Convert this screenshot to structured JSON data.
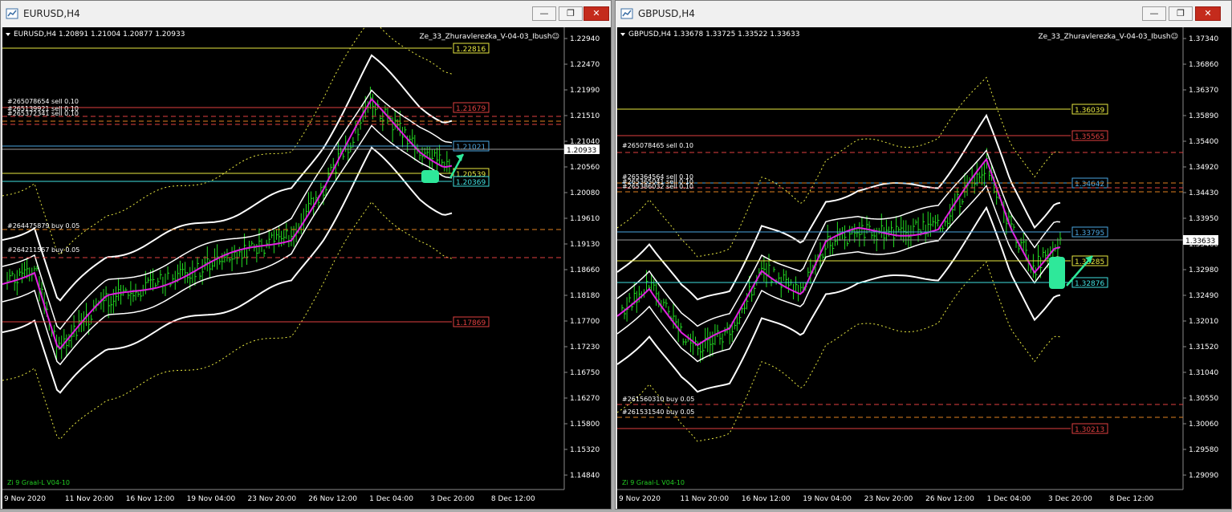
{
  "colors": {
    "bg": "#000000",
    "grid": "#3a3a3a",
    "bars": "#22dd22",
    "bands": "#ffffff",
    "midline": "#e020e0",
    "dotted": "#e8e840",
    "blue": "#4aa6e0",
    "red": "#e04040",
    "orange": "#e08020",
    "yellow": "#e8e840",
    "cyan": "#40e0e0",
    "arrow": "#2ee89a"
  },
  "windows": [
    {
      "title": "EURUSD,H4",
      "info": "EURUSD,H4  1.20891 1.21004 1.20877 1.20933",
      "expert": "Ze_33_Zhuravlerezka_V-04-03_Ibush☺",
      "indicator_label": "Zi 9 Graal-L V04-10",
      "current_price": "1.20933",
      "price_ticks": [
        "1.22940",
        "1.22470",
        "1.21990",
        "1.21510",
        "1.21040",
        "1.20560",
        "1.20080",
        "1.19610",
        "1.19130",
        "1.18660",
        "1.18180",
        "1.17700",
        "1.17230",
        "1.16750",
        "1.16270",
        "1.15800",
        "1.15320",
        "1.14840"
      ],
      "time_ticks": [
        "9 Nov 2020",
        "11 Nov 20:00",
        "16 Nov 12:00",
        "19 Nov 04:00",
        "23 Nov 20:00",
        "26 Nov 12:00",
        "1 Dec 04:00",
        "3 Dec 20:00",
        "8 Dec 12:00"
      ],
      "level_labels": [
        {
          "text": "1.22816",
          "color": "yellow"
        },
        {
          "text": "1.21679",
          "color": "red"
        },
        {
          "text": "1.21021",
          "color": "blue"
        },
        {
          "text": "1.20539",
          "color": "yellow"
        },
        {
          "text": "1.20369",
          "color": "cyan"
        },
        {
          "text": "1.17869",
          "color": "red"
        }
      ],
      "order_labels": [
        "#265078654 sell 0.10",
        "#265139921 sell 0.10",
        "#265372341 sell 0.10",
        "#264475879 buy 0.05",
        "#264211557 buy 0.05"
      ]
    },
    {
      "title": "GBPUSD,H4",
      "info": "GBPUSD,H4  1.33678 1.33725 1.33522 1.33633",
      "expert": "Ze_33_Zhuravlerezka_V-04-03_Ibush☺",
      "indicator_label": "Zi 9 Graal-L V04-10",
      "current_price": "1.33633",
      "price_ticks": [
        "1.37340",
        "1.36860",
        "1.36370",
        "1.35890",
        "1.35400",
        "1.34920",
        "1.34430",
        "1.33950",
        "1.33460",
        "1.32980",
        "1.32490",
        "1.32010",
        "1.31520",
        "1.31040",
        "1.30550",
        "1.30060",
        "1.29580",
        "1.29090"
      ],
      "time_ticks": [
        "9 Nov 2020",
        "11 Nov 20:00",
        "16 Nov 12:00",
        "19 Nov 04:00",
        "23 Nov 20:00",
        "26 Nov 12:00",
        "1 Dec 04:00",
        "3 Dec 20:00",
        "8 Dec 12:00"
      ],
      "level_labels": [
        {
          "text": "1.36039",
          "color": "yellow"
        },
        {
          "text": "1.35565",
          "color": "red"
        },
        {
          "text": "1.34642",
          "color": "blue"
        },
        {
          "text": "1.33795",
          "color": "blue"
        },
        {
          "text": "1.33285",
          "color": "yellow"
        },
        {
          "text": "1.32876",
          "color": "cyan"
        },
        {
          "text": "1.30213",
          "color": "red"
        }
      ],
      "order_labels": [
        "#265078465 sell 0.10",
        "#265364564 sell 0.10",
        "#265365041 sell 0.10",
        "#265386032 sell 0.10",
        "#261560310 buy 0.05",
        "#261531540 buy 0.05"
      ]
    }
  ]
}
